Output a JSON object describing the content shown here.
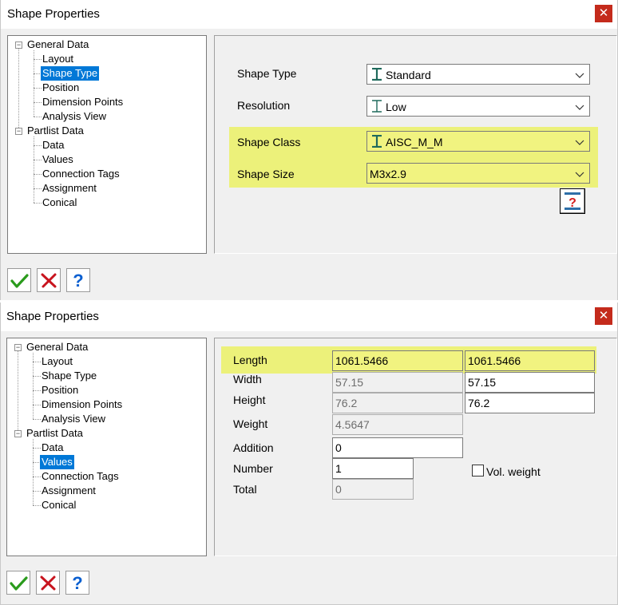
{
  "dialog1": {
    "title": "Shape Properties",
    "close_glyph": "✕",
    "tree": {
      "general": "General Data",
      "layout": "Layout",
      "shape_type": "Shape Type",
      "position": "Position",
      "dimension_points": "Dimension Points",
      "analysis_view": "Analysis View",
      "partlist": "Partlist Data",
      "data": "Data",
      "values": "Values",
      "connection_tags": "Connection Tags",
      "assignment": "Assignment",
      "conical": "Conical",
      "selected": "Shape Type"
    },
    "fields": {
      "shape_type_label": "Shape Type",
      "shape_type_value": "Standard",
      "resolution_label": "Resolution",
      "resolution_value": "Low",
      "shape_class_label": "Shape Class",
      "shape_class_value": "AISC_M_M",
      "shape_size_label": "Shape Size",
      "shape_size_value": "M3x2.9"
    },
    "icons": {
      "beam": "i-beam-icon",
      "chevron": "chevron-down-icon",
      "info": "shape-info-icon"
    },
    "buttons": {
      "ok": "ok-checkmark-icon",
      "cancel": "cancel-x-icon",
      "help": "help-question-icon"
    }
  },
  "dialog2": {
    "title": "Shape Properties",
    "close_glyph": "✕",
    "tree": {
      "general": "General Data",
      "layout": "Layout",
      "shape_type": "Shape Type",
      "position": "Position",
      "dimension_points": "Dimension Points",
      "analysis_view": "Analysis View",
      "partlist": "Partlist Data",
      "data": "Data",
      "values": "Values",
      "connection_tags": "Connection Tags",
      "assignment": "Assignment",
      "conical": "Conical",
      "selected": "Values"
    },
    "values": {
      "length_label": "Length",
      "length_a": "1061.5466",
      "length_b": "1061.5466",
      "width_label": "Width",
      "width_a": "57.15",
      "width_b": "57.15",
      "height_label": "Height",
      "height_a": "76.2",
      "height_b": "76.2",
      "weight_label": "Weight",
      "weight_a": "4.5647",
      "addition_label": "Addition",
      "addition_value": "0",
      "number_label": "Number",
      "number_value": "1",
      "total_label": "Total",
      "total_value": "0",
      "vol_weight_label": "Vol. weight",
      "vol_weight_checked": false
    },
    "buttons": {
      "ok": "ok-checkmark-icon",
      "cancel": "cancel-x-icon",
      "help": "help-question-icon"
    }
  },
  "colors": {
    "highlight": "#ecf17a",
    "selection": "#0078d7",
    "close": "#c42b1c",
    "beam_icon": "#1f6a5c"
  }
}
